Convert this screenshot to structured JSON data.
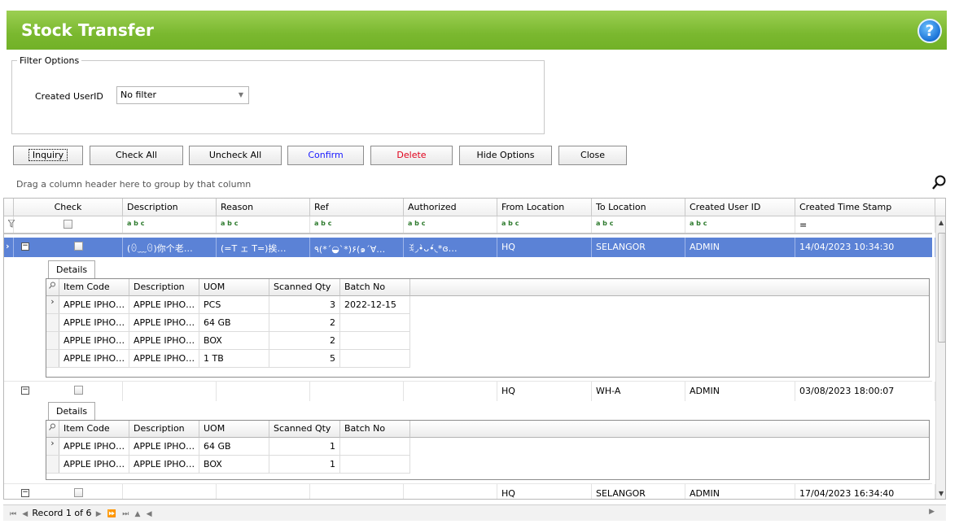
{
  "window": {
    "title": "Stock Transfer",
    "help_icon": "help-icon",
    "help_glyph": "?"
  },
  "filter": {
    "legend": "Filter Options",
    "created_user_label": "Created UserID",
    "created_user_value": "No filter"
  },
  "buttons": {
    "inquiry": "Inquiry",
    "check_all": "Check All",
    "uncheck_all": "Uncheck All",
    "confirm": "Confirm",
    "delete": "Delete",
    "hide_options": "Hide Options",
    "close": "Close"
  },
  "colors": {
    "confirm": "#1a1aff",
    "delete": "#e0001b",
    "titlebar": "#7ab82f",
    "selected_row": "#5b82d6"
  },
  "grid": {
    "group_hint": "Drag a column header here to group by that column",
    "columns": [
      "Check",
      "Description",
      "Reason",
      "Ref",
      "Authorized",
      "From Location",
      "To Location",
      "Created User ID",
      "Created Time Stamp"
    ],
    "filter_marker": "a b c",
    "timestamp_filter": "=",
    "rows": [
      {
        "description": "(ꏿ﹏ꏿ)你个老…",
        "reason": "(=T ェ T=)挨…",
        "ref": "٩(*´◒`*)۶(๑´∀…",
        "authorized": "ꉂ◞•̀ᴗ•́◟*ɞ…",
        "from": "HQ",
        "to": "SELANGOR",
        "user": "ADMIN",
        "timestamp": "14/04/2023 10:34:30",
        "detail_tab": "Details",
        "items": [
          {
            "item_code": "APPLE IPHO…",
            "description": "APPLE IPHO…",
            "uom": "PCS",
            "qty": "3",
            "batch": "2022-12-15"
          },
          {
            "item_code": "APPLE IPHO…",
            "description": "APPLE IPHO…",
            "uom": "64 GB",
            "qty": "2",
            "batch": ""
          },
          {
            "item_code": "APPLE IPHO…",
            "description": "APPLE IPHO…",
            "uom": "BOX",
            "qty": "2",
            "batch": ""
          },
          {
            "item_code": "APPLE IPHO…",
            "description": "APPLE IPHO…",
            "uom": "1 TB",
            "qty": "5",
            "batch": ""
          }
        ]
      },
      {
        "description": "",
        "reason": "",
        "ref": "",
        "authorized": "",
        "from": "HQ",
        "to": "WH-A",
        "user": "ADMIN",
        "timestamp": "03/08/2023 18:00:07",
        "detail_tab": "Details",
        "items": [
          {
            "item_code": "APPLE IPHO…",
            "description": "APPLE IPHO…",
            "uom": "64 GB",
            "qty": "1",
            "batch": ""
          },
          {
            "item_code": "APPLE IPHO…",
            "description": "APPLE IPHO…",
            "uom": "BOX",
            "qty": "1",
            "batch": ""
          }
        ]
      },
      {
        "description": "",
        "reason": "",
        "ref": "",
        "authorized": "",
        "from": "HQ",
        "to": "SELANGOR",
        "user": "ADMIN",
        "timestamp": "17/04/2023 16:34:40"
      }
    ],
    "detail_columns": [
      "Item Code",
      "Description",
      "UOM",
      "Scanned Qty",
      "Batch No"
    ]
  },
  "navigator": {
    "record_text": "Record 1 of 6"
  }
}
